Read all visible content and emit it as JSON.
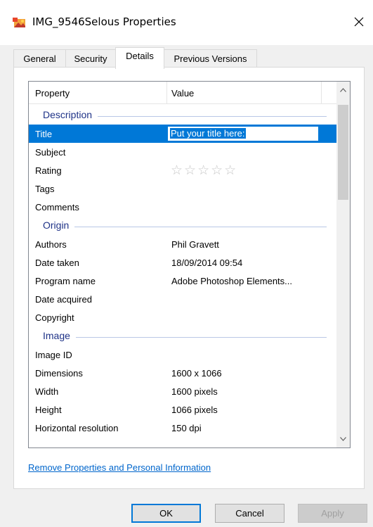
{
  "window": {
    "title": "IMG_9546Selous Properties"
  },
  "tabs": [
    {
      "label": "General"
    },
    {
      "label": "Security"
    },
    {
      "label": "Details"
    },
    {
      "label": "Previous Versions"
    }
  ],
  "listview": {
    "headers": {
      "property": "Property",
      "value": "Value"
    },
    "groups": {
      "description": "Description",
      "origin": "Origin",
      "image": "Image"
    },
    "rows": {
      "title": {
        "property": "Title",
        "value": "Put your title here:"
      },
      "subject": {
        "property": "Subject",
        "value": ""
      },
      "rating": {
        "property": "Rating",
        "value": "☆☆☆☆☆"
      },
      "tags": {
        "property": "Tags",
        "value": ""
      },
      "comments": {
        "property": "Comments",
        "value": ""
      },
      "authors": {
        "property": "Authors",
        "value": "Phil Gravett"
      },
      "date_taken": {
        "property": "Date taken",
        "value": "18/09/2014 09:54"
      },
      "program_name": {
        "property": "Program name",
        "value": "Adobe Photoshop Elements..."
      },
      "date_acquired": {
        "property": "Date acquired",
        "value": ""
      },
      "copyright": {
        "property": "Copyright",
        "value": ""
      },
      "image_id": {
        "property": "Image ID",
        "value": ""
      },
      "dimensions": {
        "property": "Dimensions",
        "value": "1600 x 1066"
      },
      "width": {
        "property": "Width",
        "value": "1600 pixels"
      },
      "height": {
        "property": "Height",
        "value": "1066 pixels"
      },
      "horizontal_resolution": {
        "property": "Horizontal resolution",
        "value": "150 dpi"
      }
    }
  },
  "link": "Remove Properties and Personal Information",
  "buttons": {
    "ok": "OK",
    "cancel": "Cancel",
    "apply": "Apply"
  },
  "colors": {
    "accent": "#0078d7",
    "group_title": "#1e3287",
    "link": "#0066cc"
  }
}
